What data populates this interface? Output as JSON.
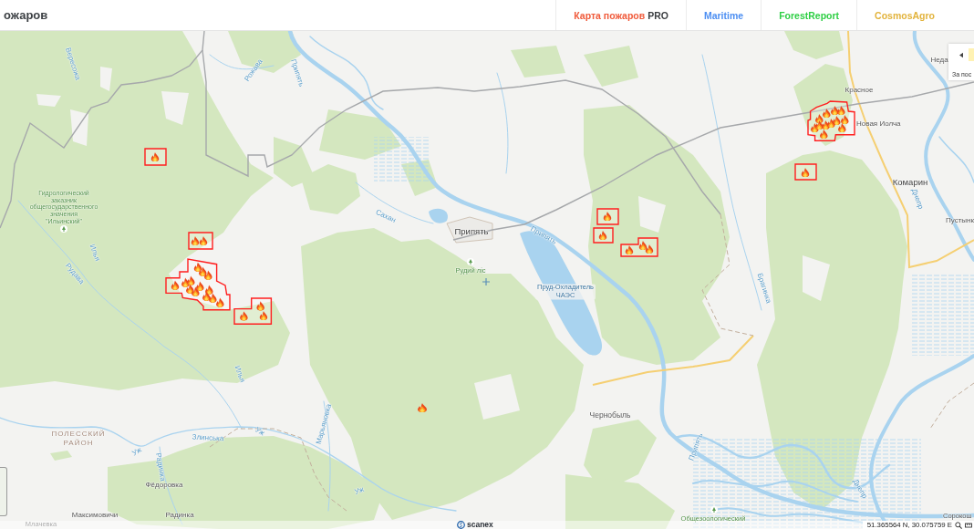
{
  "header": {
    "title": "ожаров",
    "nav": [
      {
        "label": "Карта пожаров",
        "suffix": "PRO",
        "color": "#f05a3a"
      },
      {
        "label": "Maritime",
        "color": "#4d8ff2"
      },
      {
        "label": "ForestReport",
        "color": "#2fcf45"
      },
      {
        "label": "CosmosAgro",
        "color": "#e2b33c"
      }
    ]
  },
  "map": {
    "settlements": [
      "Припять",
      "Чернобыль",
      "Красное",
      "Новая Иолча",
      "Комарин",
      "Пустынк",
      "Неда",
      "Фёдоровка",
      "Максимовичи",
      "Радинка",
      "Млачевка",
      "Сорокош"
    ],
    "district": "ПОЛЕССКИЙ РАЙОН",
    "reserves": [
      "Гидрологический\nзаказник\nобщегосударственного\nзначения\n\"Ильинский\"",
      "Рудий ліс",
      "Общезоологический"
    ],
    "water_labels": [
      "Пруд-Охладитель ЧАЭС"
    ],
    "rivers": [
      "Вересожа",
      "Рожава",
      "Припять",
      "Илья",
      "Рудава",
      "Сахан",
      "Припять",
      "Брагинка",
      "Илья",
      "Злинська",
      "Уж",
      "Уж",
      "Радинка",
      "Марьяновка",
      "Уж",
      "Днепр",
      "Припять",
      "Днепр"
    ]
  },
  "period_panel": {
    "caption": "За пос"
  },
  "status_bar": {
    "logo": "scanex",
    "coordinates": "51.365564 N, 30.075759 E"
  }
}
